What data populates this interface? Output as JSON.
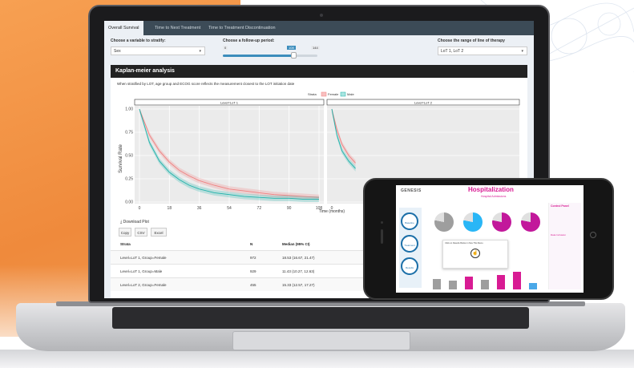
{
  "tabs": [
    {
      "label": "Overall Survival",
      "active": true
    },
    {
      "label": "Time to Next Treatment",
      "active": false
    },
    {
      "label": "Time to Treatment Discontinuation",
      "active": false
    }
  ],
  "controls": {
    "stratify_label": "Choose a variable to stratify:",
    "stratify_value": "Sex",
    "followup_label": "Choose a follow-up period:",
    "followup_min": "0",
    "followup_value": "108",
    "followup_max": "144",
    "followup_fraction": 0.75,
    "lot_label": "Choose the range of line of therapy",
    "lot_value": "LoT 1, LoT 2"
  },
  "panel": {
    "title": "Kaplan-meier analysis",
    "description": "When stratified by LOT, age group and ECOG score reflects the measurement closest to the LOT initiation date"
  },
  "chart_data": {
    "type": "line",
    "ylabel": "Survival Rate",
    "xlabel": "Time (months)",
    "legend_title": "Strata",
    "series": [
      {
        "name": "Female",
        "color": "#f08080"
      },
      {
        "name": "Male",
        "color": "#20b2aa"
      }
    ],
    "facets": [
      "Level=LoT 1",
      "Level=LoT 2"
    ],
    "y_ticks": [
      "1.00",
      "0.75",
      "0.50",
      "0.25",
      "0.00"
    ],
    "x_ticks": [
      "0",
      "18",
      "36",
      "54",
      "72",
      "90",
      "108"
    ],
    "x_ticks_facet2": [
      "0"
    ],
    "ylim": [
      0,
      1
    ],
    "xlim": [
      0,
      108
    ],
    "curves_facet1": {
      "Female": [
        [
          0,
          1.0
        ],
        [
          6,
          0.72
        ],
        [
          12,
          0.55
        ],
        [
          18,
          0.43
        ],
        [
          24,
          0.34
        ],
        [
          30,
          0.28
        ],
        [
          36,
          0.23
        ],
        [
          45,
          0.18
        ],
        [
          54,
          0.14
        ],
        [
          63,
          0.12
        ],
        [
          72,
          0.1
        ],
        [
          81,
          0.08
        ],
        [
          90,
          0.07
        ],
        [
          99,
          0.06
        ],
        [
          108,
          0.05
        ]
      ],
      "Male": [
        [
          0,
          1.0
        ],
        [
          6,
          0.64
        ],
        [
          12,
          0.44
        ],
        [
          18,
          0.32
        ],
        [
          24,
          0.24
        ],
        [
          30,
          0.18
        ],
        [
          36,
          0.14
        ],
        [
          45,
          0.1
        ],
        [
          54,
          0.08
        ],
        [
          63,
          0.06
        ],
        [
          72,
          0.05
        ],
        [
          81,
          0.04
        ],
        [
          90,
          0.04
        ],
        [
          99,
          0.03
        ],
        [
          108,
          0.03
        ]
      ]
    },
    "curves_facet2": {
      "Female": [
        [
          0,
          1.0
        ],
        [
          3,
          0.78
        ],
        [
          6,
          0.62
        ],
        [
          10,
          0.5
        ],
        [
          14,
          0.42
        ]
      ],
      "Male": [
        [
          0,
          1.0
        ],
        [
          3,
          0.72
        ],
        [
          6,
          0.55
        ],
        [
          10,
          0.44
        ],
        [
          14,
          0.36
        ]
      ]
    }
  },
  "download": {
    "label": "Download Plot"
  },
  "export_buttons": [
    "Copy",
    "CSV",
    "Excel"
  ],
  "table": {
    "headers": [
      "Strata",
      "N",
      "Median (95% CI)"
    ],
    "rows": [
      {
        "strata": "Level=LoT 1, Group=Female",
        "n": "972",
        "median": "18.53 (16.67, 21.47)"
      },
      {
        "strata": "Level=LoT 1, Group=Male",
        "n": "929",
        "median": "11.43 (10.27, 12.63)"
      },
      {
        "strata": "Level=LoT 2, Group=Female",
        "n": "455",
        "median": "15.33 (12.57, 17.27)"
      }
    ]
  },
  "phone": {
    "logo": "GENESIS",
    "title": "Hospitalization",
    "subtitle": "Hospital Admissions",
    "nav": [
      "Baseline",
      "Treatment",
      "Results"
    ],
    "hint": "Click on Results Button in Nav This Menu",
    "side_title": "Control Panel",
    "side_sub": "Data Inclusion",
    "pie_colors": [
      "#9e9e9e",
      "#29b6f6",
      "#c2189b",
      "#c2189b"
    ],
    "bar_values": [
      0.55,
      0.45,
      0.65,
      0.5,
      0.75,
      0.9,
      0.35
    ]
  }
}
